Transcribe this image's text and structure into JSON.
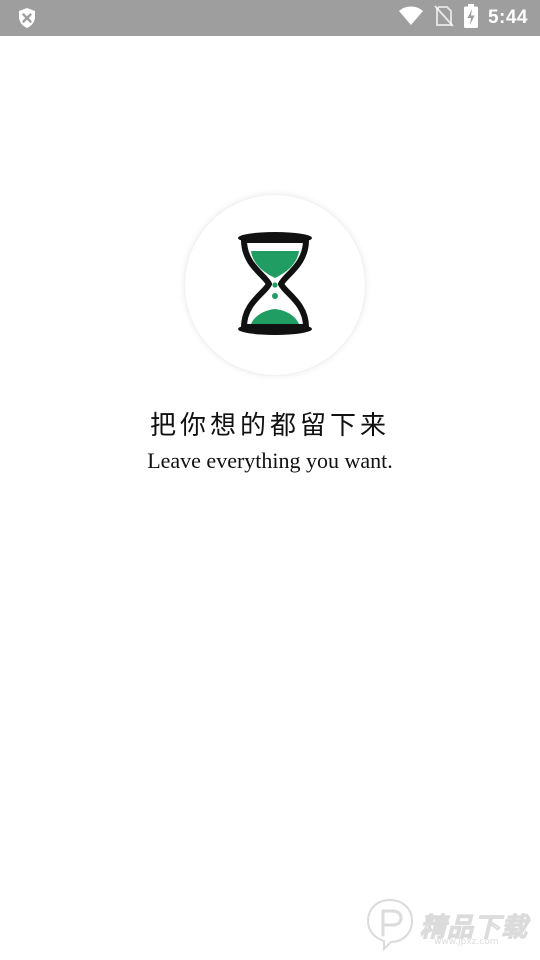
{
  "status_bar": {
    "time": "5:44",
    "icons": [
      "shield-x-icon",
      "wifi-icon",
      "no-sim-icon",
      "battery-charging-icon"
    ],
    "background": "#9e9e9e"
  },
  "splash": {
    "logo_icon": "hourglass-icon",
    "accent_color": "#1f9d62",
    "slogan_cn": "把你想的都留下来",
    "slogan_en": "Leave everything you want."
  },
  "watermark": {
    "text": "精品下载",
    "sub": "www.jpxz.com"
  }
}
